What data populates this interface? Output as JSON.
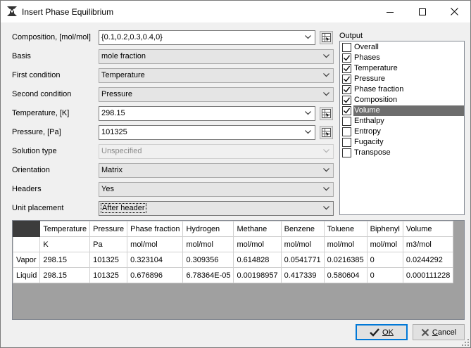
{
  "window": {
    "title": "Insert Phase Equilibrium",
    "app_icon": "phase-diagram-icon",
    "controls": [
      "minimize-icon",
      "maximize-icon",
      "close-icon"
    ]
  },
  "form": {
    "composition": {
      "label": "Composition, [mol/mol]",
      "value": "{0.1,0.2,0.3,0.4,0}"
    },
    "basis": {
      "label": "Basis",
      "value": "mole fraction"
    },
    "first_condition": {
      "label": "First condition",
      "value": "Temperature"
    },
    "second_condition": {
      "label": "Second condition",
      "value": "Pressure"
    },
    "temperature": {
      "label": "Temperature, [K]",
      "value": "298.15"
    },
    "pressure": {
      "label": "Pressure, [Pa]",
      "value": "101325"
    },
    "solution_type": {
      "label": "Solution type",
      "value": "Unspecified"
    },
    "orientation": {
      "label": "Orientation",
      "value": "Matrix"
    },
    "headers": {
      "label": "Headers",
      "value": "Yes"
    },
    "unit_placement": {
      "label": "Unit placement",
      "value": "After header"
    }
  },
  "output": {
    "label": "Output",
    "items": [
      {
        "label": "Overall",
        "checked": false,
        "selected": false
      },
      {
        "label": "Phases",
        "checked": true,
        "selected": false
      },
      {
        "label": "Temperature",
        "checked": true,
        "selected": false
      },
      {
        "label": "Pressure",
        "checked": true,
        "selected": false
      },
      {
        "label": "Phase fraction",
        "checked": true,
        "selected": false
      },
      {
        "label": "Composition",
        "checked": true,
        "selected": false
      },
      {
        "label": "Volume",
        "checked": true,
        "selected": true
      },
      {
        "label": "Enthalpy",
        "checked": false,
        "selected": false
      },
      {
        "label": "Entropy",
        "checked": false,
        "selected": false
      },
      {
        "label": "Fugacity",
        "checked": false,
        "selected": false
      },
      {
        "label": "Transpose",
        "checked": false,
        "selected": false
      }
    ]
  },
  "preview": {
    "columns": [
      "Temperature",
      "Pressure",
      "Phase fraction",
      "Hydrogen",
      "Methane",
      "Benzene",
      "Toluene",
      "Biphenyl",
      "Volume"
    ],
    "units": [
      "K",
      "Pa",
      "mol/mol",
      "mol/mol",
      "mol/mol",
      "mol/mol",
      "mol/mol",
      "mol/mol",
      "m3/mol"
    ],
    "rows": [
      {
        "phase": "Vapor",
        "cells": [
          "298.15",
          "101325",
          "0.323104",
          "0.309356",
          "0.614828",
          "0.0541771",
          "0.0216385",
          "0",
          "0.0244292"
        ]
      },
      {
        "phase": "Liquid",
        "cells": [
          "298.15",
          "101325",
          "0.676896",
          "6.78364E-05",
          "0.00198957",
          "0.417339",
          "0.580604",
          "0",
          "0.000111228"
        ]
      }
    ]
  },
  "buttons": {
    "ok": {
      "label": "OK",
      "icon": "checkmark-icon"
    },
    "cancel": {
      "label": "Cancel",
      "icon": "cancel-x-icon"
    }
  }
}
